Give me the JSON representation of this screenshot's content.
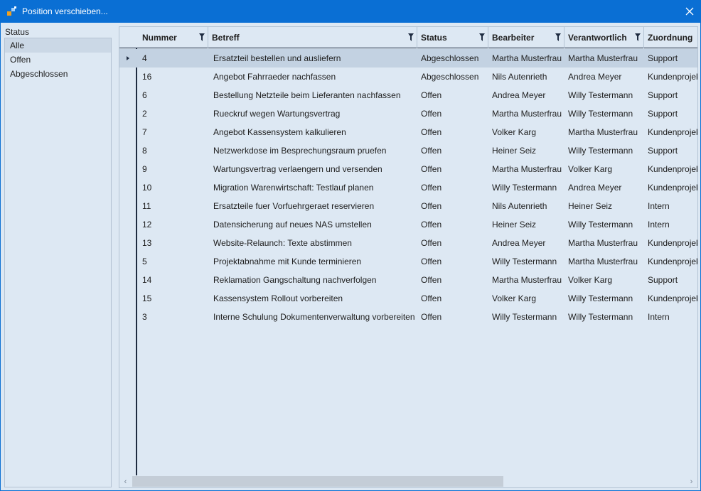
{
  "window": {
    "title": "Position verschieben..."
  },
  "status_panel": {
    "label": "Status",
    "items": [
      {
        "label": "Alle",
        "selected": true
      },
      {
        "label": "Offen",
        "selected": false
      },
      {
        "label": "Abgeschlossen",
        "selected": false
      }
    ]
  },
  "grid": {
    "columns": [
      {
        "label": "Nummer",
        "filter": true
      },
      {
        "label": "Betreff",
        "filter": true
      },
      {
        "label": "Status",
        "filter": true
      },
      {
        "label": "Bearbeiter",
        "filter": true
      },
      {
        "label": "Verantwortlich",
        "filter": true
      },
      {
        "label": "Zuordnung",
        "filter": false
      }
    ],
    "rows": [
      {
        "nummer": "4",
        "betreff": "Ersatzteil bestellen und ausliefern",
        "status": "Abgeschlossen",
        "bearbeiter": "Martha Musterfrau",
        "verantwortlich": "Martha Musterfrau",
        "zuordnung": "Support",
        "selected": true
      },
      {
        "nummer": "16",
        "betreff": "Angebot Fahrraeder nachfassen",
        "status": "Abgeschlossen",
        "bearbeiter": "Nils Autenrieth",
        "verantwortlich": "Andrea Meyer",
        "zuordnung": "Kundenprojekt"
      },
      {
        "nummer": "6",
        "betreff": "Bestellung Netzteile beim Lieferanten nachfassen",
        "status": "Offen",
        "bearbeiter": "Andrea Meyer",
        "verantwortlich": "Willy Testermann",
        "zuordnung": "Support"
      },
      {
        "nummer": "2",
        "betreff": "Rueckruf wegen Wartungsvertrag",
        "status": "Offen",
        "bearbeiter": "Martha Musterfrau",
        "verantwortlich": "Willy Testermann",
        "zuordnung": "Support"
      },
      {
        "nummer": "7",
        "betreff": "Angebot Kassensystem kalkulieren",
        "status": "Offen",
        "bearbeiter": "Volker Karg",
        "verantwortlich": "Martha Musterfrau",
        "zuordnung": "Kundenprojekt"
      },
      {
        "nummer": "8",
        "betreff": "Netzwerkdose im Besprechungsraum pruefen",
        "status": "Offen",
        "bearbeiter": "Heiner Seiz",
        "verantwortlich": "Willy Testermann",
        "zuordnung": "Support"
      },
      {
        "nummer": "9",
        "betreff": "Wartungsvertrag verlaengern und versenden",
        "status": "Offen",
        "bearbeiter": "Martha Musterfrau",
        "verantwortlich": "Volker Karg",
        "zuordnung": "Kundenprojekt"
      },
      {
        "nummer": "10",
        "betreff": "Migration Warenwirtschaft: Testlauf planen",
        "status": "Offen",
        "bearbeiter": "Willy Testermann",
        "verantwortlich": "Andrea Meyer",
        "zuordnung": "Kundenprojekt"
      },
      {
        "nummer": "11",
        "betreff": "Ersatzteile fuer Vorfuehrgeraet reservieren",
        "status": "Offen",
        "bearbeiter": "Nils Autenrieth",
        "verantwortlich": "Heiner Seiz",
        "zuordnung": "Intern"
      },
      {
        "nummer": "12",
        "betreff": "Datensicherung auf neues NAS umstellen",
        "status": "Offen",
        "bearbeiter": "Heiner Seiz",
        "verantwortlich": "Willy Testermann",
        "zuordnung": "Intern"
      },
      {
        "nummer": "13",
        "betreff": "Website-Relaunch: Texte abstimmen",
        "status": "Offen",
        "bearbeiter": "Andrea Meyer",
        "verantwortlich": "Martha Musterfrau",
        "zuordnung": "Kundenprojekt"
      },
      {
        "nummer": "5",
        "betreff": "Projektabnahme mit Kunde terminieren",
        "status": "Offen",
        "bearbeiter": "Willy Testermann",
        "verantwortlich": "Martha Musterfrau",
        "zuordnung": "Kundenprojekt"
      },
      {
        "nummer": "14",
        "betreff": "Reklamation Gangschaltung nachverfolgen",
        "status": "Offen",
        "bearbeiter": "Martha Musterfrau",
        "verantwortlich": "Volker Karg",
        "zuordnung": "Support"
      },
      {
        "nummer": "15",
        "betreff": "Kassensystem Rollout vorbereiten",
        "status": "Offen",
        "bearbeiter": "Volker Karg",
        "verantwortlich": "Willy Testermann",
        "zuordnung": "Kundenprojekt"
      },
      {
        "nummer": "3",
        "betreff": "Interne Schulung Dokumentenverwaltung vorbereiten",
        "status": "Offen",
        "bearbeiter": "Willy Testermann",
        "verantwortlich": "Willy Testermann",
        "zuordnung": "Intern"
      }
    ]
  },
  "icons": {
    "app": "app-icon",
    "close": "close-icon",
    "filter": "filter-icon",
    "row_indicator": "row-indicator-icon",
    "scroll_left": "chevron-left-icon",
    "scroll_right": "chevron-right-icon"
  },
  "colors": {
    "titlebar": "#0a6fd4",
    "background": "#dde8f3",
    "selection": "#c3d2e2"
  }
}
